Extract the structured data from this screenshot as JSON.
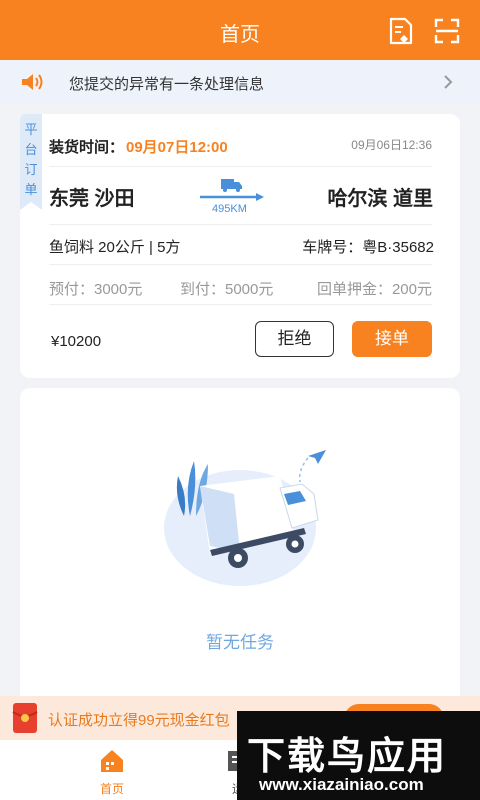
{
  "header": {
    "title": "首页",
    "icons": [
      "document-icon",
      "scan-icon"
    ]
  },
  "notice": {
    "text": "您提交的异常有一条处理信息"
  },
  "order": {
    "tag": [
      "平",
      "台",
      "订",
      "单"
    ],
    "load_label": "装货时间：",
    "load_time": "09月07日12:00",
    "posted": "09月06日12:36",
    "from": "东莞  沙田",
    "to": "哈尔滨  道里",
    "distance": "495KM",
    "cargo": "鱼饲料   20公斤 | 5方",
    "plate": "车牌号：粤B·35682",
    "prepay": "预付：3000元",
    "onarrival": "到付：5000元",
    "deposit": "回单押金：200元",
    "price": "¥10200",
    "reject": "拒绝",
    "accept": "接单"
  },
  "empty_state": {
    "text": "暂无任务"
  },
  "promo": {
    "text": "认证成功立得99元现金红包"
  },
  "tabs": [
    {
      "label": "首页",
      "active": true
    },
    {
      "label": "运"
    }
  ],
  "watermark": {
    "line1": "下载鸟应用",
    "line2": "www.xiazainiao.com"
  },
  "colors": {
    "accent": "#f7821f",
    "blue": "#4a8fd9"
  }
}
